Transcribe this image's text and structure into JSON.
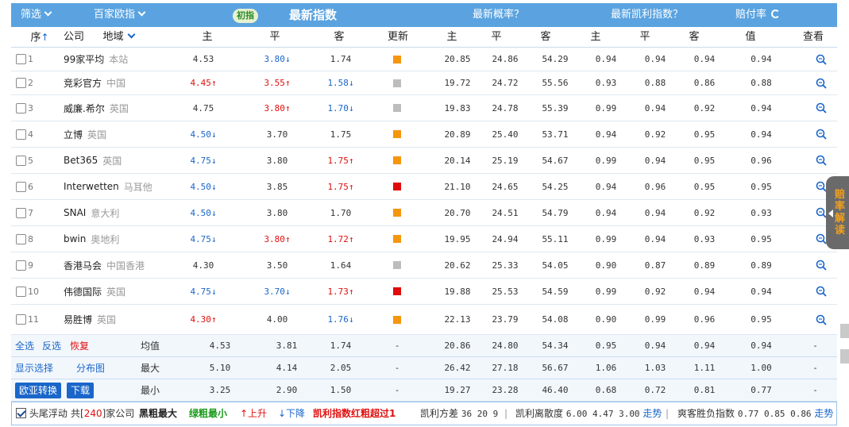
{
  "top_bar": {
    "filter_label": "筛选",
    "companies_label": "百家欧指",
    "initial_badge": "初指",
    "latest_index": "最新指数",
    "latest_prob": "最新概率？",
    "latest_kelly": "最新凯利指数？",
    "payout_rate": "赔付率"
  },
  "headers": {
    "seq": "序",
    "company": "公司",
    "region": "地域",
    "home": "主",
    "draw": "平",
    "away": "客",
    "update": "更新",
    "p_home": "主",
    "p_draw": "平",
    "p_away": "客",
    "k_home": "主",
    "k_draw": "平",
    "k_away": "客",
    "value": "值",
    "view": "查看"
  },
  "colors": {
    "orange": "#f5960f",
    "gray": "#bdbdbd",
    "red": "#e00b0b",
    "up": "#e01010",
    "down": "#1a66c9"
  },
  "rows": [
    {
      "seq": "1",
      "company": "99家平均",
      "region": "本站",
      "home": "4.53",
      "home_t": "",
      "draw": "3.80",
      "draw_t": "down",
      "away": "1.74",
      "away_t": "",
      "upd": "orange",
      "ph": "20.85",
      "pd": "24.86",
      "pa": "54.29",
      "kh": "0.94",
      "kd": "0.94",
      "ka": "0.94",
      "val": "0.94"
    },
    {
      "seq": "2",
      "company": "竞彩官方",
      "region": "中国",
      "home": "4.45",
      "home_t": "up",
      "draw": "3.55",
      "draw_t": "up",
      "away": "1.58",
      "away_t": "down",
      "upd": "gray",
      "ph": "19.72",
      "pd": "24.72",
      "pa": "55.56",
      "kh": "0.93",
      "kd": "0.88",
      "ka": "0.86",
      "val": "0.88"
    },
    {
      "seq": "3",
      "company": "威廉.希尔",
      "region": "英国",
      "home": "4.75",
      "home_t": "",
      "draw": "3.80",
      "draw_t": "up",
      "away": "1.70",
      "away_t": "down",
      "upd": "gray",
      "ph": "19.83",
      "pd": "24.78",
      "pa": "55.39",
      "kh": "0.99",
      "kd": "0.94",
      "ka": "0.92",
      "val": "0.94"
    },
    {
      "seq": "4",
      "company": "立博",
      "region": "英国",
      "home": "4.50",
      "home_t": "down",
      "draw": "3.70",
      "draw_t": "",
      "away": "1.75",
      "away_t": "",
      "upd": "orange",
      "ph": "20.89",
      "pd": "25.40",
      "pa": "53.71",
      "kh": "0.94",
      "kd": "0.92",
      "ka": "0.95",
      "val": "0.94"
    },
    {
      "seq": "5",
      "company": "Bet365",
      "region": "英国",
      "home": "4.75",
      "home_t": "down",
      "draw": "3.80",
      "draw_t": "",
      "away": "1.75",
      "away_t": "up",
      "upd": "orange",
      "ph": "20.14",
      "pd": "25.19",
      "pa": "54.67",
      "kh": "0.99",
      "kd": "0.94",
      "ka": "0.95",
      "val": "0.96"
    },
    {
      "seq": "6",
      "company": "Interwetten",
      "region": "马耳他",
      "home": "4.50",
      "home_t": "down",
      "draw": "3.85",
      "draw_t": "",
      "away": "1.75",
      "away_t": "up",
      "upd": "red",
      "ph": "21.10",
      "pd": "24.65",
      "pa": "54.25",
      "kh": "0.94",
      "kd": "0.96",
      "ka": "0.95",
      "val": "0.95"
    },
    {
      "seq": "7",
      "company": "SNAI",
      "region": "意大利",
      "home": "4.50",
      "home_t": "down",
      "draw": "3.80",
      "draw_t": "",
      "away": "1.70",
      "away_t": "",
      "upd": "orange",
      "ph": "20.70",
      "pd": "24.51",
      "pa": "54.79",
      "kh": "0.94",
      "kd": "0.94",
      "ka": "0.92",
      "val": "0.93"
    },
    {
      "seq": "8",
      "company": "bwin",
      "region": "奥地利",
      "home": "4.75",
      "home_t": "down",
      "draw": "3.80",
      "draw_t": "up",
      "away": "1.72",
      "away_t": "up",
      "upd": "orange",
      "ph": "19.95",
      "pd": "24.94",
      "pa": "55.11",
      "kh": "0.99",
      "kd": "0.94",
      "ka": "0.93",
      "val": "0.95"
    },
    {
      "seq": "9",
      "company": "香港马会",
      "region": "中国香港",
      "home": "4.30",
      "home_t": "",
      "draw": "3.50",
      "draw_t": "",
      "away": "1.64",
      "away_t": "",
      "upd": "gray",
      "ph": "20.62",
      "pd": "25.33",
      "pa": "54.05",
      "kh": "0.90",
      "kd": "0.87",
      "ka": "0.89",
      "val": "0.89"
    },
    {
      "seq": "10",
      "company": "伟德国际",
      "region": "英国",
      "home": "4.75",
      "home_t": "down",
      "draw": "3.70",
      "draw_t": "down",
      "away": "1.73",
      "away_t": "up",
      "upd": "red",
      "ph": "19.88",
      "pd": "25.53",
      "pa": "54.59",
      "kh": "0.99",
      "kd": "0.92",
      "ka": "0.94",
      "val": "0.94"
    },
    {
      "seq": "11",
      "company": "易胜博",
      "region": "英国",
      "home": "4.30",
      "home_t": "up",
      "draw": "4.00",
      "draw_t": "",
      "away": "1.76",
      "away_t": "down",
      "upd": "orange",
      "ph": "22.13",
      "pd": "23.79",
      "pa": "54.08",
      "kh": "0.90",
      "kd": "0.99",
      "ka": "0.96",
      "val": "0.95"
    }
  ],
  "footer": {
    "select_all": "全选",
    "invert": "反选",
    "restore": "恢复",
    "show_selected": "显示选择",
    "distribution": "分布图",
    "convert_btn": "欧亚转换",
    "download_btn": "下载",
    "stats": [
      {
        "label": "均值",
        "home": "4.53",
        "draw": "3.81",
        "away": "1.74",
        "upd": "-",
        "ph": "20.86",
        "pd": "24.80",
        "pa": "54.34",
        "kh": "0.95",
        "kd": "0.94",
        "ka": "0.94",
        "val": "0.94",
        "view": "-"
      },
      {
        "label": "最大",
        "home": "5.10",
        "draw": "4.14",
        "away": "2.05",
        "upd": "-",
        "ph": "26.42",
        "pd": "27.18",
        "pa": "56.67",
        "kh": "1.06",
        "kd": "1.03",
        "ka": "1.11",
        "val": "1.00",
        "view": "-"
      },
      {
        "label": "最小",
        "home": "3.25",
        "draw": "2.90",
        "away": "1.50",
        "upd": "-",
        "ph": "19.27",
        "pd": "23.28",
        "pa": "46.40",
        "kh": "0.68",
        "kd": "0.72",
        "ka": "0.81",
        "val": "0.77",
        "view": "-"
      }
    ]
  },
  "bottom_bar": {
    "float_label": "头尾浮动",
    "total_prefix": "共[",
    "total_count": "240",
    "total_suffix": "]家公司",
    "black_bold": "黑粗最大",
    "green_bold": "绿粗最小",
    "rise": "↑上升",
    "fall": "↓下降",
    "kelly_red": "凯利指数红粗超过1",
    "kelly_var_label": "凯利方差",
    "kelly_var_vals": "36 20 9",
    "kelly_disp_label": "凯利离散度",
    "kelly_disp_vals": "6.00 4.47 3.00",
    "trend1": "走势",
    "payout_label": "爽客胜负指数",
    "payout_vals": "0.77 0.85 0.86",
    "trend2": "走势"
  },
  "side_tab": {
    "label": "赔率解读"
  }
}
